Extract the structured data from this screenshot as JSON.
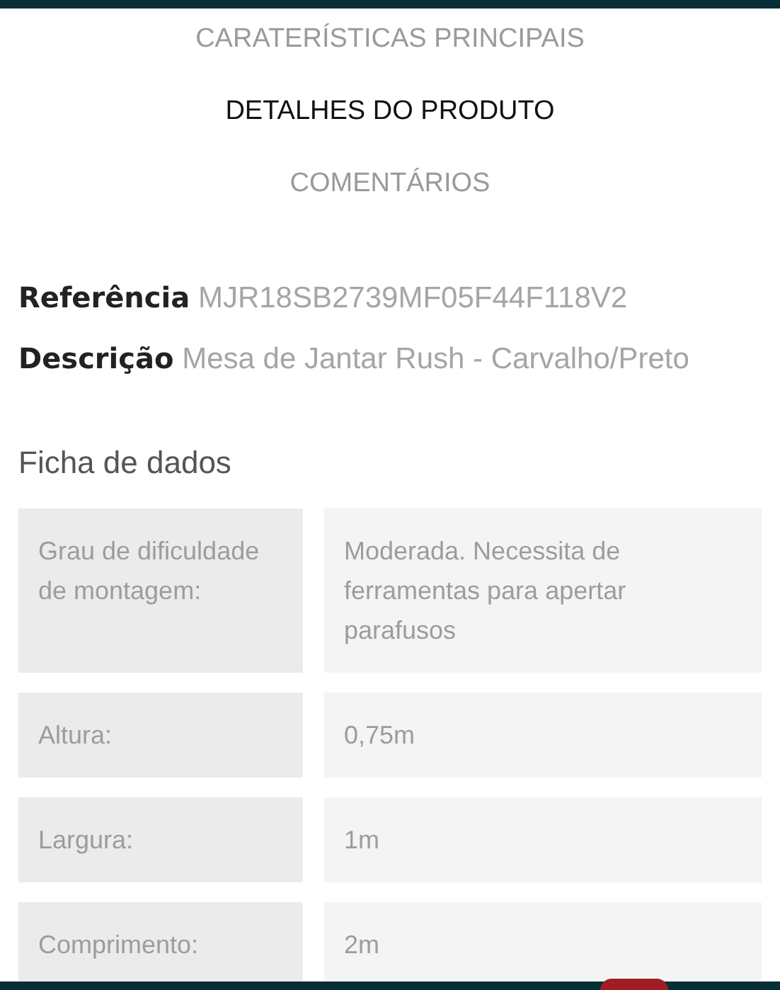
{
  "tabs": [
    {
      "label": "CARATERÍSTICAS PRINCIPAIS",
      "selected": false
    },
    {
      "label": "DETALHES DO PRODUTO",
      "selected": true
    },
    {
      "label": "COMENTÁRIOS",
      "selected": false
    }
  ],
  "details": [
    {
      "label": "Referência",
      "value": "MJR18SB2739MF05F44F118V2"
    },
    {
      "label": "Descrição",
      "value": "Mesa de Jantar Rush - Carvalho/Preto"
    }
  ],
  "datasheet": {
    "title": "Ficha de dados",
    "rows": [
      {
        "label": "Grau de dificuldade de montagem:",
        "value": "Moderada. Necessita de ferramentas para apertar parafusos"
      },
      {
        "label": "Altura:",
        "value": "0,75m"
      },
      {
        "label": "Largura:",
        "value": "1m"
      },
      {
        "label": "Comprimento:",
        "value": "2m"
      }
    ]
  }
}
